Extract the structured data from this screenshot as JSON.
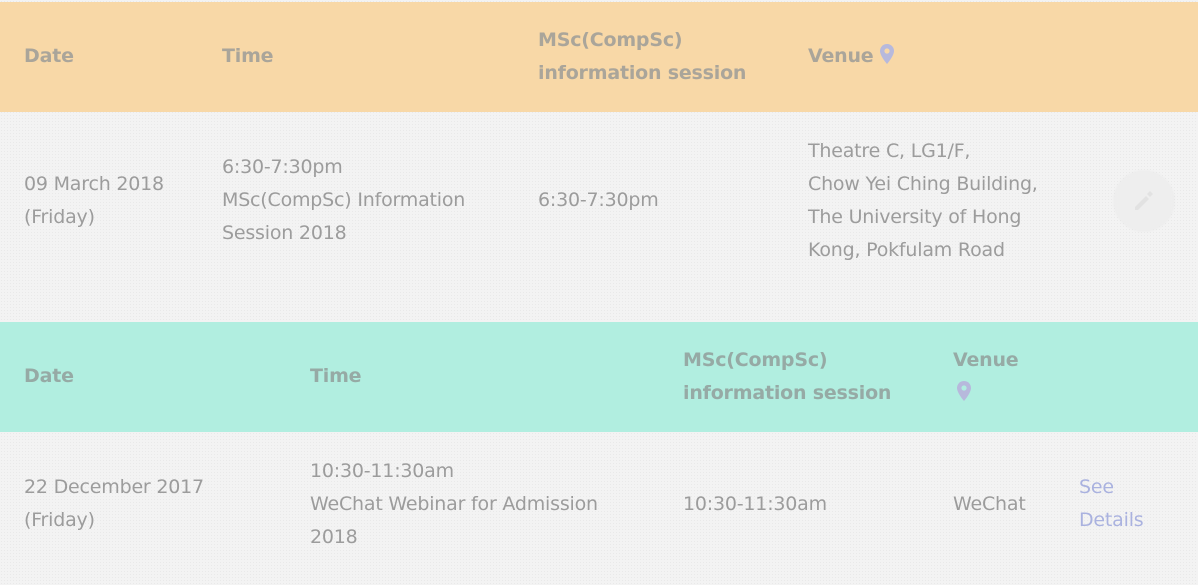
{
  "table1": {
    "headers": {
      "date": "Date",
      "time": "Time",
      "session_line1": "MSc(CompSc)",
      "session_line2": "information session",
      "venue": "Venue"
    },
    "row": {
      "date_line1": "09 March 2018",
      "date_line2": "(Friday)",
      "time_line1": "6:30-7:30pm",
      "time_line2": "MSc(CompSc) Information",
      "time_line3": "Session 2018",
      "session": "6:30-7:30pm",
      "venue_line1": "Theatre C, LG1/F,",
      "venue_line2": "Chow Yei Ching Building,",
      "venue_line3": "The University of Hong",
      "venue_line4": "Kong, Pokfulam Road"
    }
  },
  "table2": {
    "headers": {
      "date": "Date",
      "time": "Time",
      "session_line1": "MSc(CompSc)",
      "session_line2": "information session",
      "venue": "Venue"
    },
    "row": {
      "date_line1": "22 December 2017",
      "date_line2": "(Friday)",
      "time_line1": "10:30-11:30am",
      "time_line2": "WeChat Webinar for Admission",
      "time_line3": "2018",
      "session": "10:30-11:30am",
      "venue": "WeChat",
      "details_line1": "See",
      "details_line2": "Details"
    }
  },
  "icons": {
    "venue": "map-pin-icon",
    "edit": "pencil-icon"
  },
  "colors": {
    "orange_header": "#f8d8a7",
    "teal_header": "#b1eee0",
    "pin": "#b7b9dc",
    "link": "#aab2df"
  }
}
